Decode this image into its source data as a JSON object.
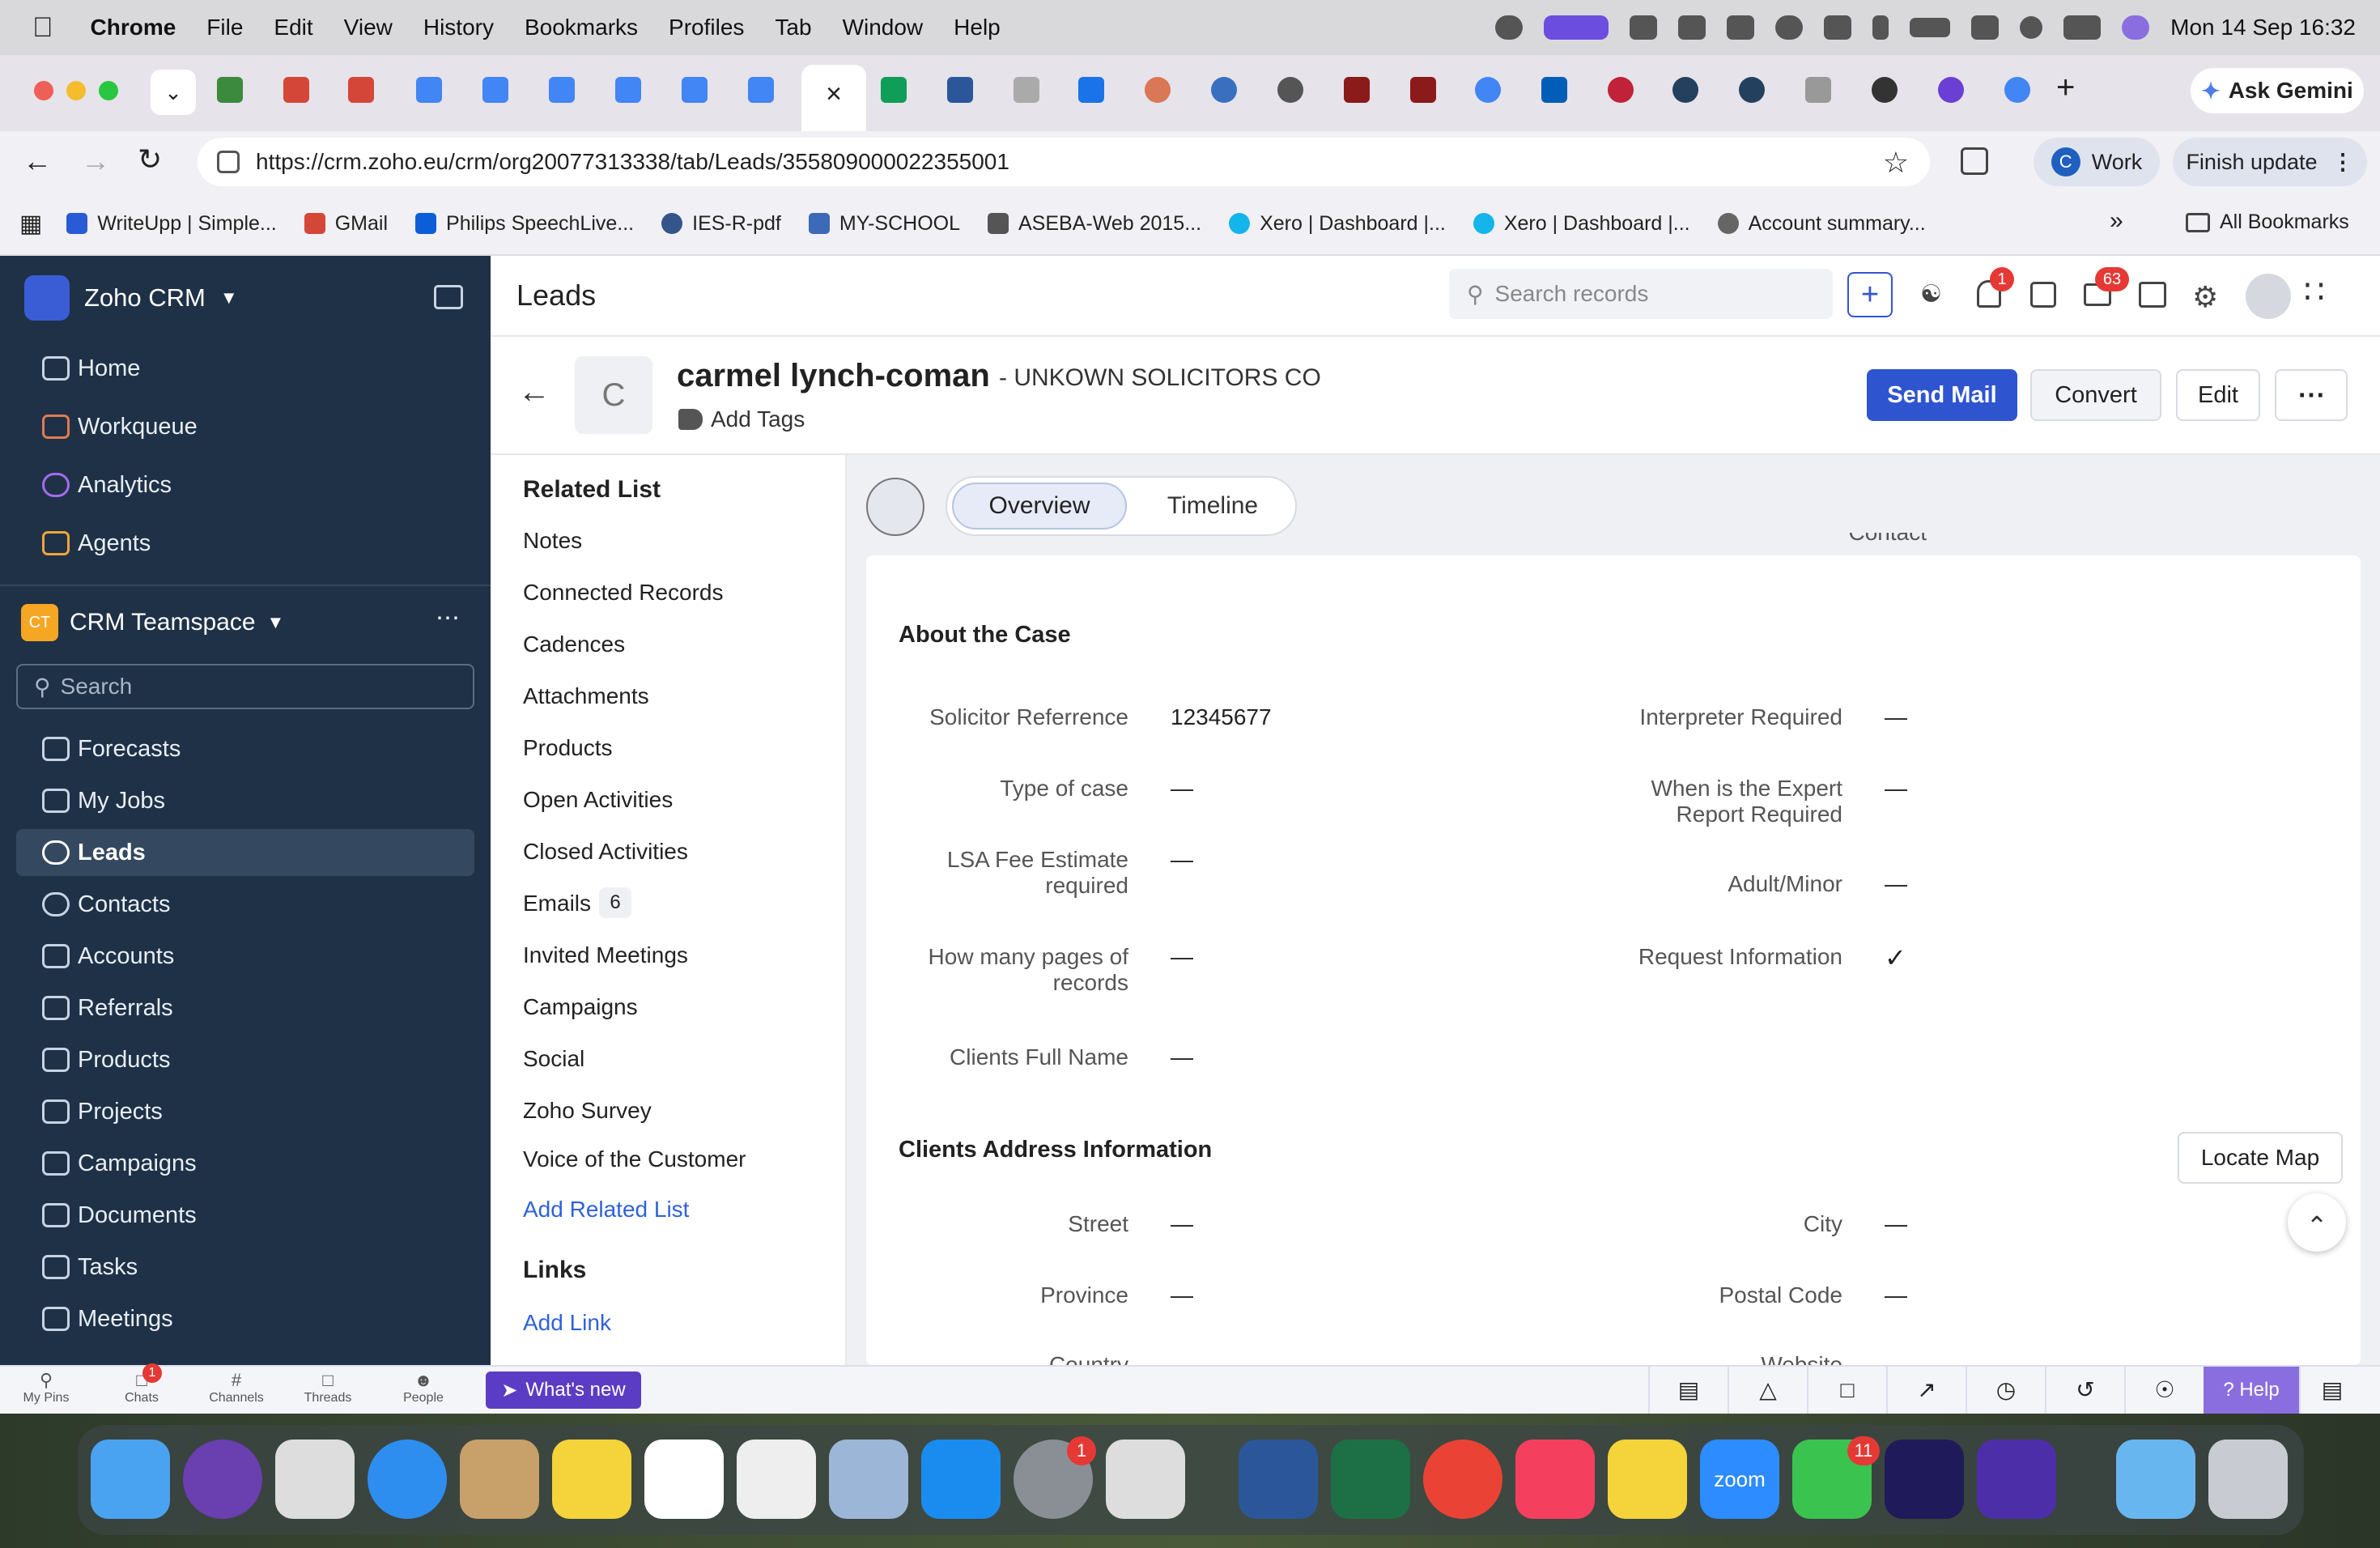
{
  "menubar": {
    "app": "Chrome",
    "items": [
      "File",
      "Edit",
      "View",
      "History",
      "Bookmarks",
      "Profiles",
      "Tab",
      "Window",
      "Help"
    ],
    "datetime": "Mon 14 Sep  16:32"
  },
  "browser": {
    "gemini": "Ask Gemini",
    "url": "https://crm.zoho.eu/crm/org20077313338/tab/Leads/355809000022355001",
    "profile": "Work",
    "profile_initial": "C",
    "finish": "Finish update",
    "all_bookmarks": "All Bookmarks",
    "bookmarks": [
      "WriteUpp | Simple...",
      "GMail",
      "Philips SpeechLive...",
      "IES-R-pdf",
      "MY-SCHOOL",
      "ASEBA-Web 2015...",
      "Xero | Dashboard |...",
      "Xero | Dashboard |...",
      "Account summary..."
    ]
  },
  "crm": {
    "brand": "Zoho CRM",
    "top_nav": [
      "Home",
      "Workqueue",
      "Analytics",
      "Agents"
    ],
    "teamspace_badge": "CT",
    "teamspace": "CRM Teamspace",
    "search_placeholder": "Search",
    "modules": [
      "Forecasts",
      "My Jobs",
      "Leads",
      "Contacts",
      "Accounts",
      "Referrals",
      "Products",
      "Projects",
      "Campaigns",
      "Documents",
      "Tasks",
      "Meetings"
    ],
    "header_title": "Leads",
    "search_records": "Search records",
    "notif_count": "1",
    "mail_count": "63",
    "record": {
      "avatar": "C",
      "name": "carmel lynch-coman",
      "company": "- UNKOWN SOLICITORS CO",
      "add_tags": "Add Tags"
    },
    "actions": {
      "send_mail": "Send Mail",
      "convert": "Convert",
      "edit": "Edit"
    },
    "related": {
      "title": "Related List",
      "items": [
        "Notes",
        "Connected Records",
        "Cadences",
        "Attachments",
        "Products",
        "Open Activities",
        "Closed Activities",
        "Emails",
        "Invited Meetings",
        "Campaigns",
        "Social",
        "Zoho Survey",
        "Voice of the Customer"
      ],
      "emails_count": "6",
      "add_related": "Add Related List",
      "links_title": "Links",
      "add_link": "Add Link"
    },
    "tabs": {
      "overview": "Overview",
      "timeline": "Timeline"
    },
    "partial_top": "Contact",
    "case": {
      "title": "About the Case",
      "fields": [
        {
          "label": "Solicitor Referrence",
          "value": "12345677"
        },
        {
          "label": "Type of case",
          "value": "—"
        },
        {
          "label": "LSA Fee Estimate required",
          "value": "—"
        },
        {
          "label": "How many pages of records",
          "value": "—"
        },
        {
          "label": "Clients Full Name",
          "value": "—"
        },
        {
          "label": "Interpreter Required",
          "value": "—"
        },
        {
          "label": "When is the Expert Report Required",
          "value": "—"
        },
        {
          "label": "Adult/Minor",
          "value": "—"
        },
        {
          "label": "Request Information",
          "value": "✓"
        }
      ]
    },
    "address": {
      "title": "Clients Address Information",
      "locate": "Locate Map",
      "fields": [
        {
          "label": "Street",
          "value": "—"
        },
        {
          "label": "Province",
          "value": "—"
        },
        {
          "label": "City",
          "value": "—"
        },
        {
          "label": "Postal Code",
          "value": "—"
        }
      ],
      "partial_left": "Country",
      "partial_right": "Website"
    }
  },
  "bottombar": {
    "items": [
      "My Pins",
      "Chats",
      "Channels",
      "Threads",
      "People"
    ],
    "chats_badge": "1",
    "whats_new": "What's new",
    "help": "Help"
  },
  "dock": {
    "settings_badge": "1",
    "facetime_badge": "11",
    "zoom": "zoom"
  }
}
